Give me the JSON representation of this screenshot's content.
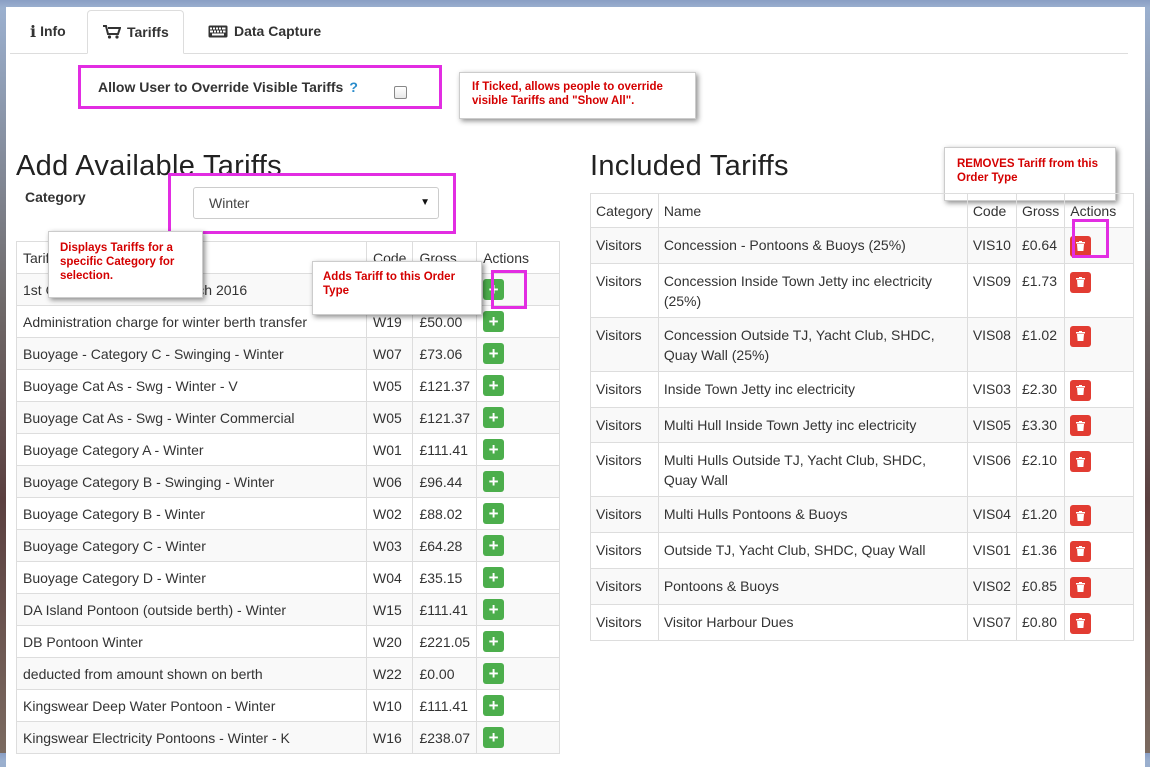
{
  "tabs": [
    {
      "label": "Info",
      "icon": "info-icon"
    },
    {
      "label": "Tariffs",
      "icon": "cart-icon"
    },
    {
      "label": "Data Capture",
      "icon": "keyboard-icon"
    }
  ],
  "override": {
    "label": "Allow User to Override Visible Tariffs",
    "help": "?"
  },
  "callouts": {
    "override": "If Ticked, allows people to override visible Tariffs and \"Show All\".",
    "removes": "REMOVES Tariff from this Order Type",
    "displays": "Displays Tariffs for a specific Category for selection.",
    "adds": "Adds Tariff to this Order Type"
  },
  "available": {
    "heading": "Add Available Tariffs",
    "category_label": "Category",
    "category_value": "Winter",
    "headers": {
      "name": "Tariff",
      "code": "Code",
      "gross": "Gross",
      "actions": "Actions"
    },
    "rows": [
      {
        "name": "1st October 2015 - 31st March 2016",
        "code": "",
        "gross": ""
      },
      {
        "name": "Administration charge for winter berth transfer",
        "code": "W19",
        "gross": "£50.00"
      },
      {
        "name": "Buoyage - Category C - Swinging - Winter",
        "code": "W07",
        "gross": "£73.06"
      },
      {
        "name": "Buoyage Cat As - Swg - Winter - V",
        "code": "W05",
        "gross": "£121.37"
      },
      {
        "name": "Buoyage Cat As - Swg - Winter Commercial",
        "code": "W05",
        "gross": "£121.37"
      },
      {
        "name": "Buoyage Category A - Winter",
        "code": "W01",
        "gross": "£111.41"
      },
      {
        "name": "Buoyage Category B - Swinging - Winter",
        "code": "W06",
        "gross": "£96.44"
      },
      {
        "name": "Buoyage Category B - Winter",
        "code": "W02",
        "gross": "£88.02"
      },
      {
        "name": "Buoyage Category C - Winter",
        "code": "W03",
        "gross": "£64.28"
      },
      {
        "name": "Buoyage Category D - Winter",
        "code": "W04",
        "gross": "£35.15"
      },
      {
        "name": "DA Island Pontoon (outside berth) - Winter",
        "code": "W15",
        "gross": "£111.41"
      },
      {
        "name": "DB Pontoon Winter",
        "code": "W20",
        "gross": "£221.05"
      },
      {
        "name": "deducted from amount shown on berth",
        "code": "W22",
        "gross": "£0.00"
      },
      {
        "name": "Kingswear Deep Water Pontoon - Winter",
        "code": "W10",
        "gross": "£111.41"
      },
      {
        "name": "Kingswear Electricity Pontoons - Winter - K",
        "code": "W16",
        "gross": "£238.07"
      }
    ]
  },
  "included": {
    "heading": "Included Tariffs",
    "headers": {
      "category": "Category",
      "name": "Name",
      "code": "Code",
      "gross": "Gross",
      "actions": "Actions"
    },
    "rows": [
      {
        "category": "Visitors",
        "name": "Concession - Pontoons & Buoys (25%)",
        "code": "VIS10",
        "gross": "£0.64"
      },
      {
        "category": "Visitors",
        "name": "Concession Inside Town Jetty inc electricity (25%)",
        "code": "VIS09",
        "gross": "£1.73"
      },
      {
        "category": "Visitors",
        "name": "Concession Outside TJ, Yacht Club, SHDC, Quay Wall (25%)",
        "code": "VIS08",
        "gross": "£1.02"
      },
      {
        "category": "Visitors",
        "name": "Inside Town Jetty inc electricity",
        "code": "VIS03",
        "gross": "£2.30"
      },
      {
        "category": "Visitors",
        "name": "Multi Hull Inside Town Jetty inc electricity",
        "code": "VIS05",
        "gross": "£3.30"
      },
      {
        "category": "Visitors",
        "name": "Multi Hulls Outside TJ, Yacht Club, SHDC, Quay Wall",
        "code": "VIS06",
        "gross": "£2.10"
      },
      {
        "category": "Visitors",
        "name": "Multi Hulls Pontoons & Buoys",
        "code": "VIS04",
        "gross": "£1.20"
      },
      {
        "category": "Visitors",
        "name": "Outside TJ, Yacht Club, SHDC, Quay Wall",
        "code": "VIS01",
        "gross": "£1.36"
      },
      {
        "category": "Visitors",
        "name": "Pontoons & Buoys",
        "code": "VIS02",
        "gross": "£0.85"
      },
      {
        "category": "Visitors",
        "name": "Visitor Harbour Dues",
        "code": "VIS07",
        "gross": "£0.80"
      }
    ]
  },
  "colors": {
    "highlight": "#e22de2",
    "add": "#4cae4c",
    "remove": "#e23c32",
    "callout_text": "#d40000"
  }
}
